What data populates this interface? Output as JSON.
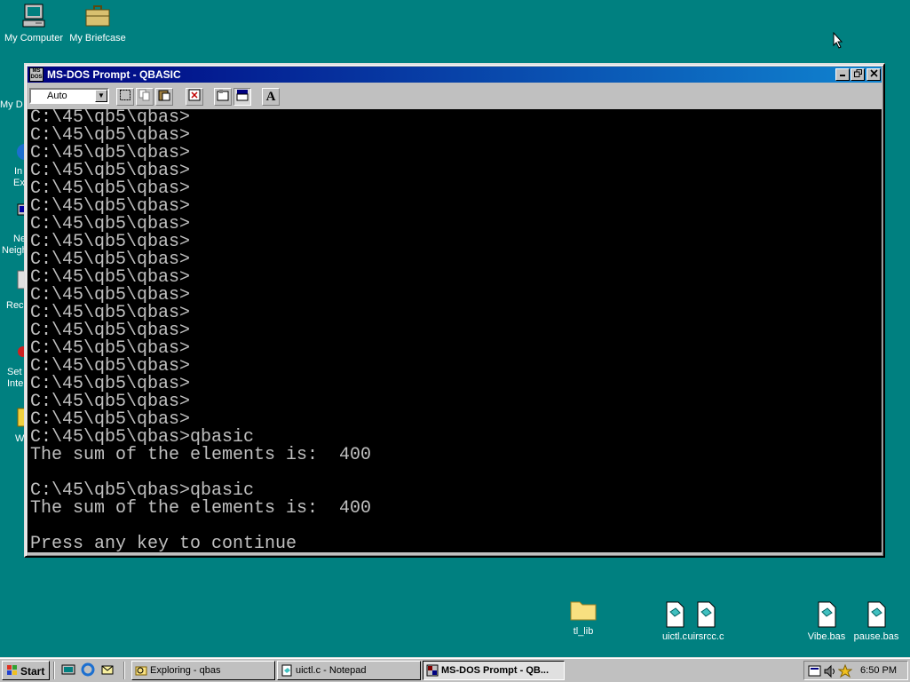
{
  "desktop": {
    "icons": [
      {
        "label": "My Computer"
      },
      {
        "label": "My Briefcase"
      },
      {
        "label": "tl_lib"
      },
      {
        "label": "uictl.c"
      },
      {
        "label": "uirsrcc.c"
      },
      {
        "label": "Vibe.bas"
      },
      {
        "label": "pause.bas"
      }
    ],
    "partial_labels": [
      "My D",
      "In",
      "Ex",
      "Ne",
      "Neigh",
      "Rec",
      "Set",
      "Inte",
      "W"
    ]
  },
  "window": {
    "title": "MS-DOS Prompt - QBASIC",
    "toolbar": {
      "font_size_value": "Auto",
      "font_button_label": "A"
    },
    "console_lines": [
      "C:\\45\\qb5\\qbas>",
      "C:\\45\\qb5\\qbas>",
      "C:\\45\\qb5\\qbas>",
      "C:\\45\\qb5\\qbas>",
      "C:\\45\\qb5\\qbas>",
      "C:\\45\\qb5\\qbas>",
      "C:\\45\\qb5\\qbas>",
      "C:\\45\\qb5\\qbas>",
      "C:\\45\\qb5\\qbas>",
      "C:\\45\\qb5\\qbas>",
      "C:\\45\\qb5\\qbas>",
      "C:\\45\\qb5\\qbas>",
      "C:\\45\\qb5\\qbas>",
      "C:\\45\\qb5\\qbas>",
      "C:\\45\\qb5\\qbas>",
      "C:\\45\\qb5\\qbas>",
      "C:\\45\\qb5\\qbas>",
      "C:\\45\\qb5\\qbas>",
      "C:\\45\\qb5\\qbas>qbasic",
      "The sum of the elements is:  400",
      "",
      "C:\\45\\qb5\\qbas>qbasic",
      "The sum of the elements is:  400",
      "",
      "Press any key to continue"
    ]
  },
  "taskbar": {
    "start_label": "Start",
    "tasks": [
      {
        "label": "Exploring - qbas"
      },
      {
        "label": "uictl.c - Notepad"
      },
      {
        "label": "MS-DOS Prompt - QB..."
      }
    ],
    "clock": "6:50 PM"
  },
  "colors": {
    "desktop": "#008080",
    "titlebar_start": "#000080",
    "titlebar_end": "#1084d0",
    "console_bg": "#000000",
    "console_fg": "#c0c0c0"
  }
}
